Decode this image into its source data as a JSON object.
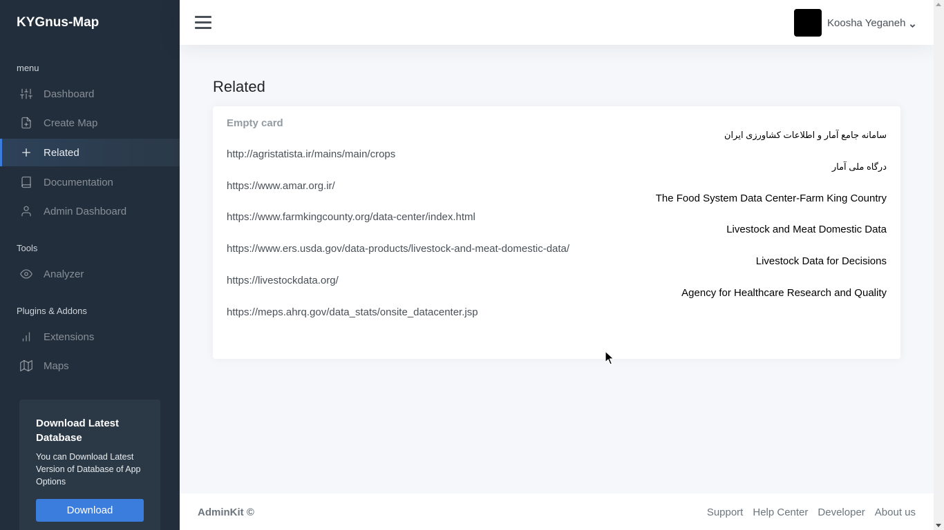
{
  "brand": "KYGnus-Map",
  "sidebar": {
    "sections": [
      {
        "header": "menu"
      },
      {
        "header": "Tools"
      },
      {
        "header": "Plugins & Addons"
      }
    ],
    "items": [
      {
        "label": "Dashboard",
        "icon": "sliders-icon"
      },
      {
        "label": "Create Map",
        "icon": "file-plus-icon"
      },
      {
        "label": "Related",
        "icon": "plus-icon",
        "active": true
      },
      {
        "label": "Documentation",
        "icon": "book-icon"
      },
      {
        "label": "Admin Dashboard",
        "icon": "user-icon"
      },
      {
        "label": "Analyzer",
        "icon": "eye-icon"
      },
      {
        "label": "Extensions",
        "icon": "bar-chart-icon"
      },
      {
        "label": "Maps",
        "icon": "map-icon"
      }
    ],
    "cta": {
      "title": "Download Latest Database",
      "text": "You can Download Latest Version of Database of App Options",
      "button": "Download"
    }
  },
  "topbar": {
    "user_name": "Koosha Yeganeh"
  },
  "page": {
    "title": "Related",
    "card_title": "Empty card",
    "links": [
      "http://agristatista.ir/mains/main/crops",
      "https://www.amar.org.ir/",
      "https://www.farmkingcounty.org/data-center/index.html",
      "https://www.ers.usda.gov/data-products/livestock-and-meat-domestic-data/",
      "https://livestockdata.org/",
      "https://meps.ahrq.gov/data_stats/onsite_datacenter.jsp"
    ],
    "sites": [
      "سامانه جامع آمار و اطلاعات کشاورزی ایران",
      "درگاه ملی آمار",
      "The Food System Data Center-Farm King Country",
      "Livestock and Meat Domestic Data",
      "Livestock Data for Decisions",
      "Agency for Healthcare Research and Quality"
    ]
  },
  "footer": {
    "brand": "AdminKit ©",
    "links": [
      "Support",
      "Help Center",
      "Developer",
      "About us"
    ]
  },
  "colors": {
    "sidebar_bg": "#222e3c",
    "accent": "#3b7ddd",
    "page_bg": "#f5f7fb"
  }
}
